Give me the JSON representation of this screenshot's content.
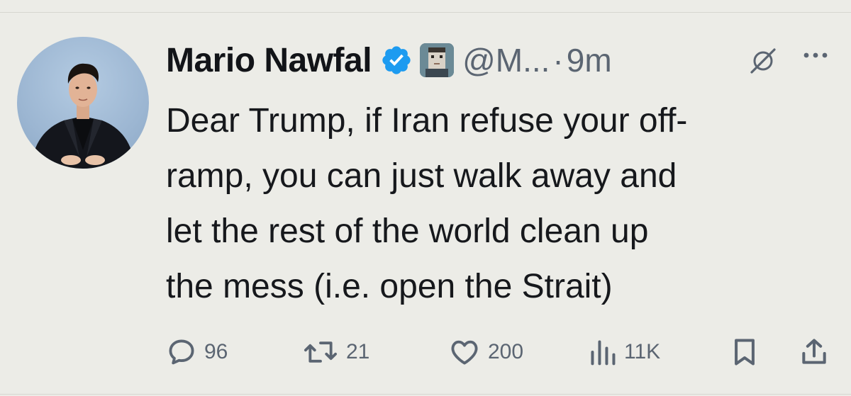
{
  "tweet": {
    "author": {
      "display_name": "Mario Nawfal",
      "handle": "@M...",
      "verified": true
    },
    "separator": "·",
    "time": "9m",
    "text": "Dear Trump, if Iran refuse your off-ramp, you can just walk away and let the rest of the world clean up the mess (i.e. open the Strait)",
    "text_lines": [
      "Dear Trump, if Iran refuse your off-",
      "ramp, you can just walk away and",
      "let the rest of the world clean up",
      "the mess (i.e. open the Strait)"
    ]
  },
  "actions": {
    "replies": "96",
    "reposts": "21",
    "likes": "200",
    "views": "11K"
  },
  "icons": {
    "reply": "reply-bubble-icon",
    "repost": "repost-arrows-icon",
    "like": "heart-icon",
    "views": "bar-chart-icon",
    "bookmark": "bookmark-icon",
    "share": "share-upload-icon",
    "grok": "grok-icon",
    "more": "more-dots-icon",
    "verified": "verified-badge-icon"
  },
  "colors": {
    "background": "#ecece7",
    "text": "#16181c",
    "muted": "#5b6572",
    "verified_blue": "#1d9bf0"
  }
}
